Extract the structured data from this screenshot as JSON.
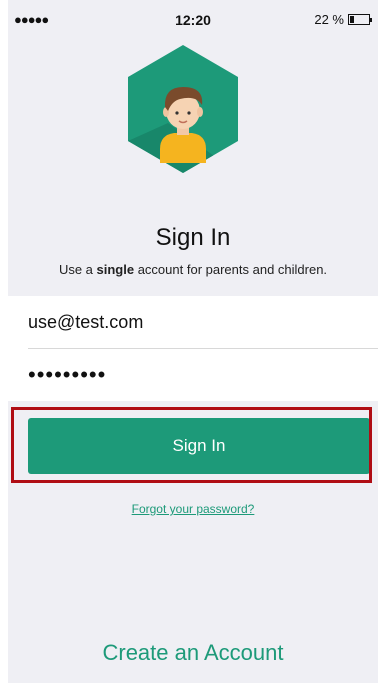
{
  "status_bar": {
    "signal": "●●●●●",
    "time": "12:20",
    "battery_percent": "22 %",
    "battery_level": 0.22
  },
  "logo": {
    "icon": "child-avatar-hexagon-icon",
    "color": "#1d9a79"
  },
  "header": {
    "title": "Sign In",
    "subtitle_prefix": "Use a ",
    "subtitle_bold": "single",
    "subtitle_suffix": " account for parents and children."
  },
  "form": {
    "email_value": "use@test.com",
    "password_mask": "•••••••••"
  },
  "actions": {
    "sign_in_label": "Sign In",
    "forgot_label": "Forgot your password?",
    "create_label": "Create an Account"
  },
  "colors": {
    "accent": "#1d9a79",
    "highlight": "#b00d14",
    "background": "#efeff4"
  }
}
